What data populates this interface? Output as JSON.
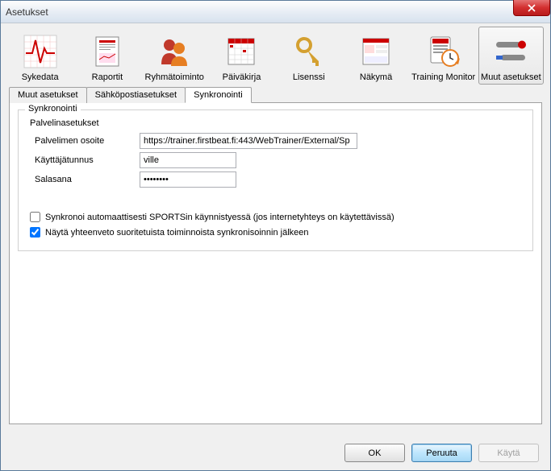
{
  "window": {
    "title": "Asetukset"
  },
  "toolbar": [
    {
      "label": "Sykedata"
    },
    {
      "label": "Raportit"
    },
    {
      "label": "Ryhmätoiminto"
    },
    {
      "label": "Päiväkirja"
    },
    {
      "label": "Lisenssi"
    },
    {
      "label": "Näkymä"
    },
    {
      "label": "Training Monitor"
    },
    {
      "label": "Muut asetukset"
    }
  ],
  "tabs": [
    {
      "label": "Muut asetukset"
    },
    {
      "label": "Sähköpostiasetukset"
    },
    {
      "label": "Synkronointi"
    }
  ],
  "sync": {
    "legend": "Synkronointi",
    "server_legend": "Palvelinasetukset",
    "rows": {
      "address_label": "Palvelimen osoite",
      "address_value": "https://trainer.firstbeat.fi:443/WebTrainer/External/Sp",
      "user_label": "Käyttäjätunnus",
      "user_value": "ville",
      "password_label": "Salasana",
      "password_value": "••••••••"
    },
    "check1_label": "Synkronoi automaattisesti SPORTSin käynnistyessä (jos internetyhteys on käytettävissä)",
    "check2_label": "Näytä yhteenveto suoritetuista toiminnoista synkronisoinnin jälkeen"
  },
  "buttons": {
    "ok": "OK",
    "cancel": "Peruuta",
    "apply": "Käytä"
  }
}
